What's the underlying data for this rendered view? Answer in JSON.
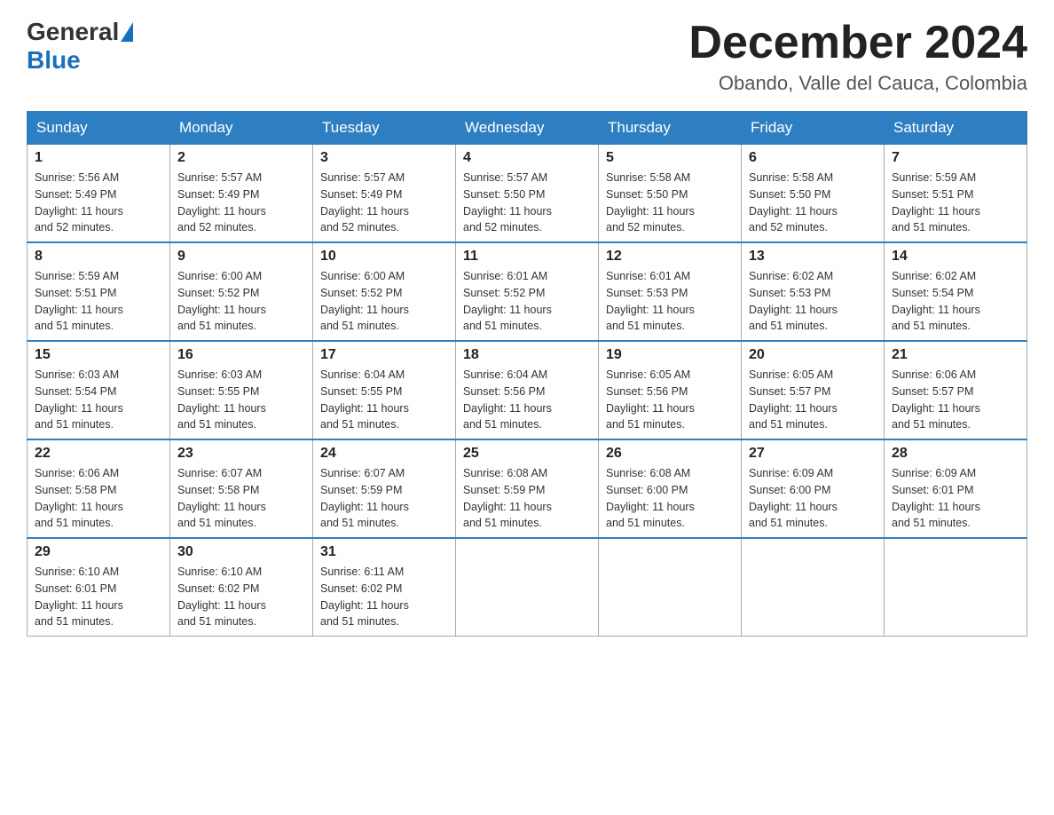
{
  "header": {
    "logo_text_1": "General",
    "logo_text_2": "Blue",
    "month_title": "December 2024",
    "location": "Obando, Valle del Cauca, Colombia"
  },
  "days_of_week": [
    "Sunday",
    "Monday",
    "Tuesday",
    "Wednesday",
    "Thursday",
    "Friday",
    "Saturday"
  ],
  "weeks": [
    [
      {
        "day": "1",
        "sunrise": "5:56 AM",
        "sunset": "5:49 PM",
        "daylight": "11 hours and 52 minutes."
      },
      {
        "day": "2",
        "sunrise": "5:57 AM",
        "sunset": "5:49 PM",
        "daylight": "11 hours and 52 minutes."
      },
      {
        "day": "3",
        "sunrise": "5:57 AM",
        "sunset": "5:49 PM",
        "daylight": "11 hours and 52 minutes."
      },
      {
        "day": "4",
        "sunrise": "5:57 AM",
        "sunset": "5:50 PM",
        "daylight": "11 hours and 52 minutes."
      },
      {
        "day": "5",
        "sunrise": "5:58 AM",
        "sunset": "5:50 PM",
        "daylight": "11 hours and 52 minutes."
      },
      {
        "day": "6",
        "sunrise": "5:58 AM",
        "sunset": "5:50 PM",
        "daylight": "11 hours and 52 minutes."
      },
      {
        "day": "7",
        "sunrise": "5:59 AM",
        "sunset": "5:51 PM",
        "daylight": "11 hours and 51 minutes."
      }
    ],
    [
      {
        "day": "8",
        "sunrise": "5:59 AM",
        "sunset": "5:51 PM",
        "daylight": "11 hours and 51 minutes."
      },
      {
        "day": "9",
        "sunrise": "6:00 AM",
        "sunset": "5:52 PM",
        "daylight": "11 hours and 51 minutes."
      },
      {
        "day": "10",
        "sunrise": "6:00 AM",
        "sunset": "5:52 PM",
        "daylight": "11 hours and 51 minutes."
      },
      {
        "day": "11",
        "sunrise": "6:01 AM",
        "sunset": "5:52 PM",
        "daylight": "11 hours and 51 minutes."
      },
      {
        "day": "12",
        "sunrise": "6:01 AM",
        "sunset": "5:53 PM",
        "daylight": "11 hours and 51 minutes."
      },
      {
        "day": "13",
        "sunrise": "6:02 AM",
        "sunset": "5:53 PM",
        "daylight": "11 hours and 51 minutes."
      },
      {
        "day": "14",
        "sunrise": "6:02 AM",
        "sunset": "5:54 PM",
        "daylight": "11 hours and 51 minutes."
      }
    ],
    [
      {
        "day": "15",
        "sunrise": "6:03 AM",
        "sunset": "5:54 PM",
        "daylight": "11 hours and 51 minutes."
      },
      {
        "day": "16",
        "sunrise": "6:03 AM",
        "sunset": "5:55 PM",
        "daylight": "11 hours and 51 minutes."
      },
      {
        "day": "17",
        "sunrise": "6:04 AM",
        "sunset": "5:55 PM",
        "daylight": "11 hours and 51 minutes."
      },
      {
        "day": "18",
        "sunrise": "6:04 AM",
        "sunset": "5:56 PM",
        "daylight": "11 hours and 51 minutes."
      },
      {
        "day": "19",
        "sunrise": "6:05 AM",
        "sunset": "5:56 PM",
        "daylight": "11 hours and 51 minutes."
      },
      {
        "day": "20",
        "sunrise": "6:05 AM",
        "sunset": "5:57 PM",
        "daylight": "11 hours and 51 minutes."
      },
      {
        "day": "21",
        "sunrise": "6:06 AM",
        "sunset": "5:57 PM",
        "daylight": "11 hours and 51 minutes."
      }
    ],
    [
      {
        "day": "22",
        "sunrise": "6:06 AM",
        "sunset": "5:58 PM",
        "daylight": "11 hours and 51 minutes."
      },
      {
        "day": "23",
        "sunrise": "6:07 AM",
        "sunset": "5:58 PM",
        "daylight": "11 hours and 51 minutes."
      },
      {
        "day": "24",
        "sunrise": "6:07 AM",
        "sunset": "5:59 PM",
        "daylight": "11 hours and 51 minutes."
      },
      {
        "day": "25",
        "sunrise": "6:08 AM",
        "sunset": "5:59 PM",
        "daylight": "11 hours and 51 minutes."
      },
      {
        "day": "26",
        "sunrise": "6:08 AM",
        "sunset": "6:00 PM",
        "daylight": "11 hours and 51 minutes."
      },
      {
        "day": "27",
        "sunrise": "6:09 AM",
        "sunset": "6:00 PM",
        "daylight": "11 hours and 51 minutes."
      },
      {
        "day": "28",
        "sunrise": "6:09 AM",
        "sunset": "6:01 PM",
        "daylight": "11 hours and 51 minutes."
      }
    ],
    [
      {
        "day": "29",
        "sunrise": "6:10 AM",
        "sunset": "6:01 PM",
        "daylight": "11 hours and 51 minutes."
      },
      {
        "day": "30",
        "sunrise": "6:10 AM",
        "sunset": "6:02 PM",
        "daylight": "11 hours and 51 minutes."
      },
      {
        "day": "31",
        "sunrise": "6:11 AM",
        "sunset": "6:02 PM",
        "daylight": "11 hours and 51 minutes."
      },
      null,
      null,
      null,
      null
    ]
  ],
  "labels": {
    "sunrise": "Sunrise:",
    "sunset": "Sunset:",
    "daylight": "Daylight:"
  }
}
